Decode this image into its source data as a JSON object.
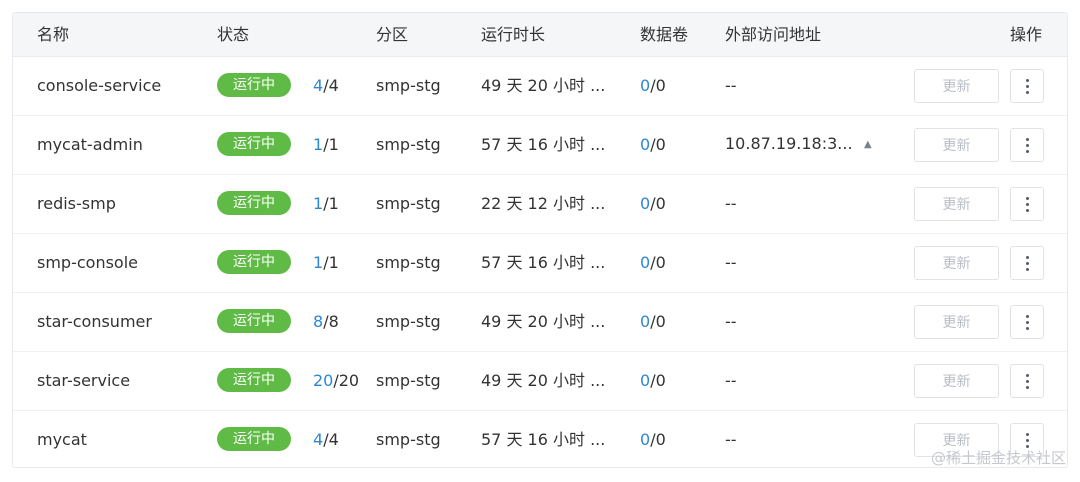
{
  "table": {
    "headers": {
      "name": "名称",
      "status": "状态",
      "partition": "分区",
      "uptime": "运行时长",
      "volumes": "数据卷",
      "external": "外部访问地址",
      "actions": "操作"
    },
    "rows": [
      {
        "name": "console-service",
        "status": "运行中",
        "ready": "4",
        "total": "/4",
        "partition": "smp-stg",
        "uptime": "49 天 20 小时 ...",
        "vol_used": "0",
        "vol_total": "/0",
        "external": "--",
        "update": "更新"
      },
      {
        "name": "mycat-admin",
        "status": "运行中",
        "ready": "1",
        "total": "/1",
        "partition": "smp-stg",
        "uptime": "57 天 16 小时 ...",
        "vol_used": "0",
        "vol_total": "/0",
        "external": "10.87.19.18:3...",
        "update": "更新"
      },
      {
        "name": "redis-smp",
        "status": "运行中",
        "ready": "1",
        "total": "/1",
        "partition": "smp-stg",
        "uptime": "22 天 12 小时 ...",
        "vol_used": "0",
        "vol_total": "/0",
        "external": "--",
        "update": "更新"
      },
      {
        "name": "smp-console",
        "status": "运行中",
        "ready": "1",
        "total": "/1",
        "partition": "smp-stg",
        "uptime": "57 天 16 小时 ...",
        "vol_used": "0",
        "vol_total": "/0",
        "external": "--",
        "update": "更新"
      },
      {
        "name": "star-consumer",
        "status": "运行中",
        "ready": "8",
        "total": "/8",
        "partition": "smp-stg",
        "uptime": "49 天 20 小时 ...",
        "vol_used": "0",
        "vol_total": "/0",
        "external": "--",
        "update": "更新"
      },
      {
        "name": "star-service",
        "status": "运行中",
        "ready": "20",
        "total": "/20",
        "partition": "smp-stg",
        "uptime": "49 天 20 小时 ...",
        "vol_used": "0",
        "vol_total": "/0",
        "external": "--",
        "update": "更新"
      },
      {
        "name": "mycat",
        "status": "运行中",
        "ready": "4",
        "total": "/4",
        "partition": "smp-stg",
        "uptime": "57 天 16 小时 ...",
        "vol_used": "0",
        "vol_total": "/0",
        "external": "--",
        "update": "更新"
      }
    ]
  },
  "icons": {
    "expand": "caret-up-icon",
    "more": "more-vertical-icon"
  },
  "colors": {
    "status_running": "#5fbb46",
    "link_blue": "#2e86d6"
  },
  "watermark": "@稀土掘金技术社区"
}
